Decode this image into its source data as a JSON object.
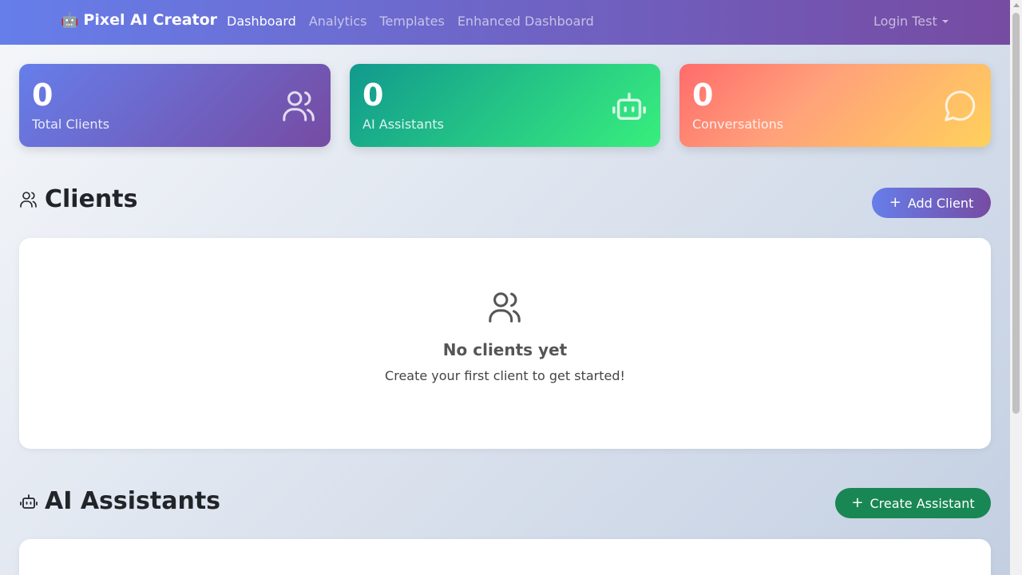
{
  "navbar": {
    "brand": "Pixel AI Creator",
    "brand_icon": "🤖",
    "links": [
      {
        "label": "Dashboard"
      },
      {
        "label": "Analytics"
      },
      {
        "label": "Templates"
      },
      {
        "label": "Enhanced Dashboard"
      }
    ],
    "user": "Login Test"
  },
  "stats": [
    {
      "value": "0",
      "label": "Total Clients",
      "icon": "users-icon"
    },
    {
      "value": "0",
      "label": "AI Assistants",
      "icon": "robot-icon"
    },
    {
      "value": "0",
      "label": "Conversations",
      "icon": "chat-bubble-icon"
    }
  ],
  "clients": {
    "title": "Clients",
    "add_button": "Add Client",
    "empty_title": "No clients yet",
    "empty_text": "Create your first client to get started!"
  },
  "assistants": {
    "title": "AI Assistants",
    "create_button": "Create Assistant"
  },
  "colors": {
    "primary_start": "#667eea",
    "primary_end": "#764ba2",
    "success": "#198754"
  }
}
